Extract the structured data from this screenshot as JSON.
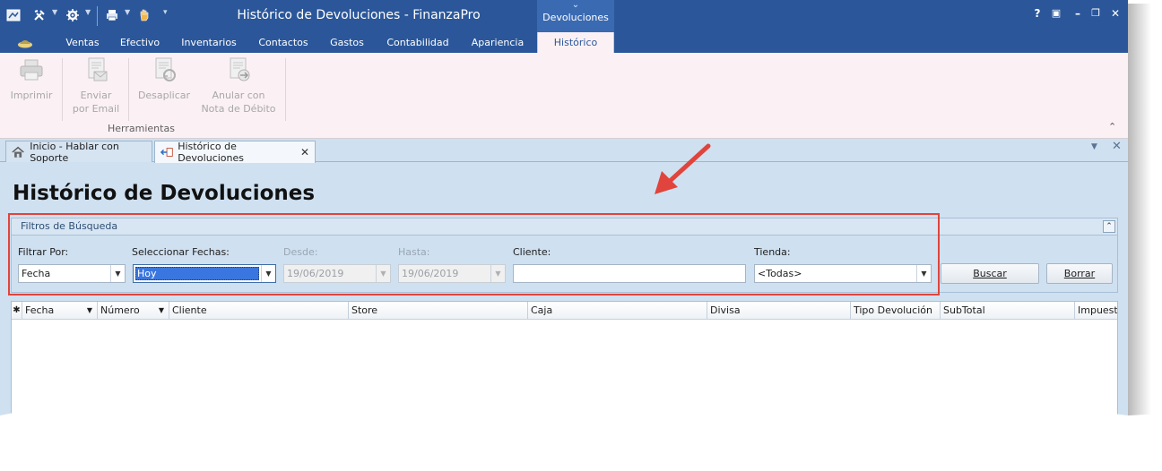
{
  "window": {
    "title": "Histórico de Devoluciones - FinanzaPro",
    "context_tab": "Devoluciones",
    "controls": [
      "?",
      "▣",
      "–",
      "❐",
      "✕"
    ]
  },
  "ribbon": {
    "tabs": [
      "Ventas",
      "Efectivo",
      "Inventarios",
      "Contactos",
      "Gastos",
      "Contabilidad",
      "Apariencia",
      "Histórico"
    ],
    "active_tab": "Histórico",
    "buttons": [
      {
        "line1": "Imprimir",
        "line2": ""
      },
      {
        "line1": "Enviar",
        "line2": "por Email"
      },
      {
        "line1": "Desaplicar",
        "line2": ""
      },
      {
        "line1": "Anular con",
        "line2": "Nota de Débito"
      }
    ],
    "group_label": "Herramientas",
    "collapse_glyph": "⌃"
  },
  "doc_tabs": [
    {
      "label": "Inicio - Hablar con Soporte",
      "active": false
    },
    {
      "label": "Histórico de Devoluciones",
      "active": true,
      "close": "✕"
    }
  ],
  "doc_controls": {
    "menu": "▼",
    "close": "✕"
  },
  "page_title": "Histórico de Devoluciones",
  "filters": {
    "title": "Filtros de Búsqueda",
    "collapse": "⌃",
    "filtrar_por": {
      "label": "Filtrar Por:",
      "value": "Fecha"
    },
    "seleccionar_fechas": {
      "label": "Seleccionar Fechas:",
      "value": "Hoy"
    },
    "desde": {
      "label": "Desde:",
      "value": "19/06/2019"
    },
    "hasta": {
      "label": "Hasta:",
      "value": "19/06/2019"
    },
    "cliente": {
      "label": "Cliente:",
      "value": ""
    },
    "tienda": {
      "label": "Tienda:",
      "value": "<Todas>"
    },
    "buscar": "Buscar",
    "borrar": "Borrar"
  },
  "grid": {
    "selector": "✱",
    "columns": [
      "Fecha",
      "Número",
      "Cliente",
      "Store",
      "Caja",
      "Divisa",
      "Tipo Devolución",
      "SubTotal",
      "Impuesto"
    ],
    "sort_glyph": "▼",
    "rows": []
  },
  "colors": {
    "titlebar": "#2b579a",
    "ribbon_bg": "#fbf1f4",
    "workspace": "#cfe0f0",
    "highlight": "#e0443c",
    "selection": "#3a76e0"
  }
}
